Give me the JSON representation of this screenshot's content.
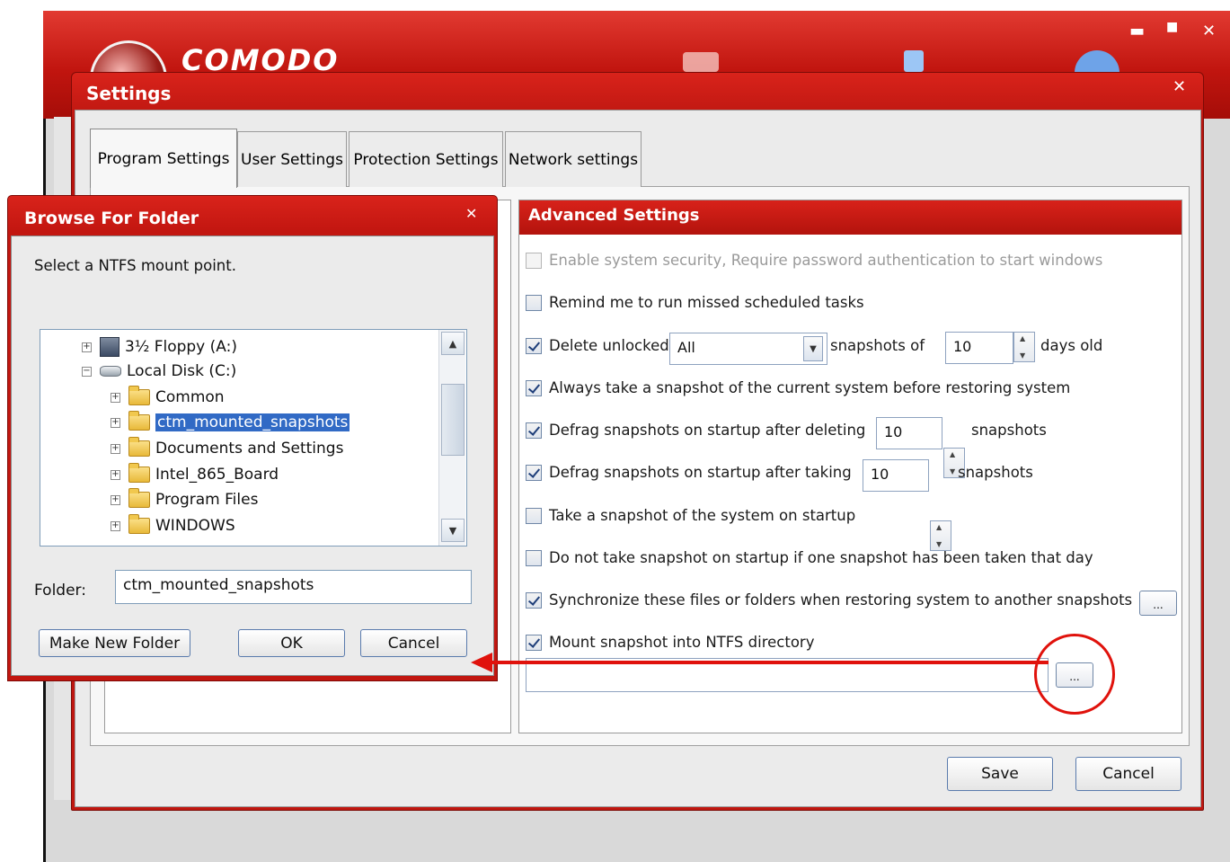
{
  "app": {
    "brand": "COMODO",
    "window_controls": {
      "minimize": "▬",
      "maximize": "■",
      "close": "✕"
    }
  },
  "settings": {
    "title": "Settings",
    "close": "✕",
    "tabs": [
      {
        "label": "Program Settings",
        "active": true
      },
      {
        "label": "User Settings"
      },
      {
        "label": "Protection Settings"
      },
      {
        "label": "Network settings"
      }
    ],
    "save_label": "Save",
    "cancel_label": "Cancel"
  },
  "advanced": {
    "header": "Advanced Settings",
    "options": {
      "system_security": "Enable system security, Require password authentication to start windows",
      "remind_missed": "Remind me to run missed scheduled tasks",
      "delete_unlocked_prefix": "Delete unlocked",
      "delete_unlocked_select": "All",
      "delete_unlocked_mid": "snapshots of",
      "delete_unlocked_days": "10",
      "delete_unlocked_suffix": "days old",
      "always_snapshot": "Always take a snapshot of the current system before restoring system",
      "defrag_deleting": "Defrag snapshots on startup after deleting",
      "defrag_deleting_value": "10",
      "defrag_deleting_suffix": "snapshots",
      "defrag_taking": "Defrag snapshots on startup after taking",
      "defrag_taking_value": "10",
      "defrag_taking_suffix": "snapshots",
      "snapshot_startup": "Take a snapshot of the system on startup",
      "no_snapshot_startup": "Do not take snapshot on startup if one snapshot has been taken that day",
      "synchronize": "Synchronize these files or folders when restoring system to another snapshots",
      "mount_ntfs": "Mount snapshot into NTFS directory",
      "mount_path": "",
      "browse_ellipsis": "..."
    }
  },
  "browse": {
    "title": "Browse For Folder",
    "close": "✕",
    "prompt": "Select a NTFS mount point.",
    "tree": [
      {
        "label": "3½ Floppy (A:)",
        "icon": "floppy-icon",
        "expander": "+"
      },
      {
        "label": "Local Disk (C:)",
        "icon": "drive-icon",
        "expander": "−"
      },
      {
        "label": "Common",
        "icon": "folder-icon",
        "expander": "+"
      },
      {
        "label": "ctm_mounted_snapshots",
        "icon": "folder-icon",
        "expander": "+",
        "selected": true
      },
      {
        "label": "Documents and Settings",
        "icon": "folder-icon",
        "expander": "+"
      },
      {
        "label": "Intel_865_Board",
        "icon": "folder-icon",
        "expander": "+"
      },
      {
        "label": "Program Files",
        "icon": "folder-icon",
        "expander": "+"
      },
      {
        "label": "WINDOWS",
        "icon": "folder-icon",
        "expander": "+"
      }
    ],
    "folder_label": "Folder:",
    "folder_value": "ctm_mounted_snapshots",
    "make_new_folder": "Make New Folder",
    "ok": "OK",
    "cancel": "Cancel"
  },
  "colors": {
    "brand_red": "#c1150f",
    "selection_blue": "#316ac5",
    "annotation_red": "#e0120c"
  }
}
